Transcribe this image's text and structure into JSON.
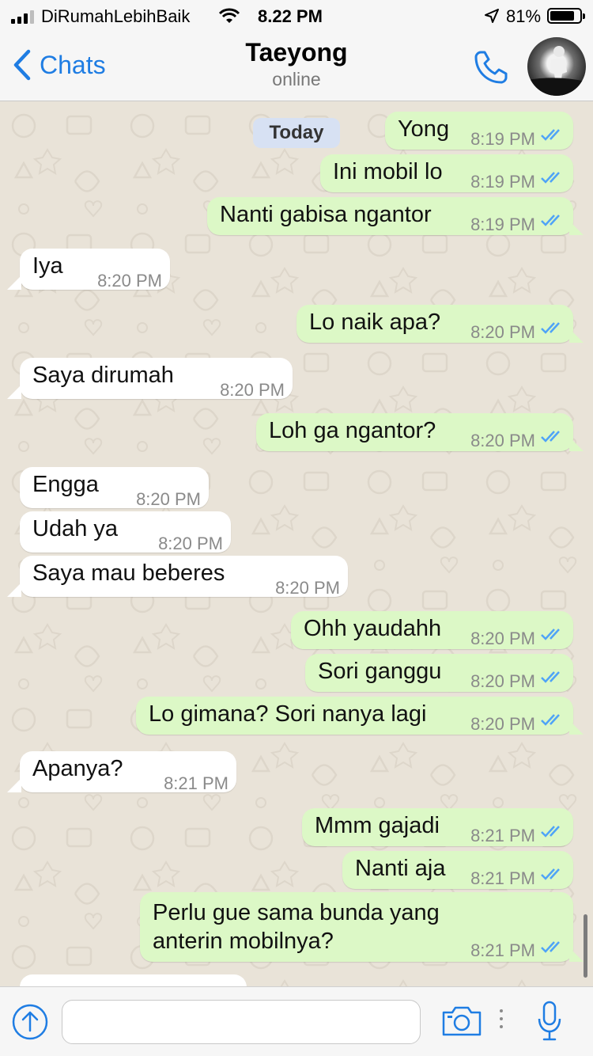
{
  "status_bar": {
    "carrier": "DiRumahLebihBaik",
    "time": "8.22 PM",
    "battery": "81%"
  },
  "header": {
    "back_label": "Chats",
    "contact_name": "Taeyong",
    "contact_status": "online"
  },
  "date_separator": "Today",
  "messages": [
    {
      "dir": "out",
      "text": "Yong",
      "time": "8:19 PM"
    },
    {
      "dir": "out",
      "text": "Ini mobil lo",
      "time": "8:19 PM"
    },
    {
      "dir": "out",
      "text": "Nanti gabisa ngantor",
      "time": "8:19 PM"
    },
    {
      "dir": "in",
      "text": "Iya",
      "time": "8:20 PM"
    },
    {
      "dir": "out",
      "text": "Lo naik apa?",
      "time": "8:20 PM"
    },
    {
      "dir": "in",
      "text": "Saya dirumah",
      "time": "8:20 PM"
    },
    {
      "dir": "out",
      "text": "Loh ga ngantor?",
      "time": "8:20 PM"
    },
    {
      "dir": "in",
      "text": "Engga",
      "time": "8:20 PM"
    },
    {
      "dir": "in",
      "text": "Udah ya",
      "time": "8:20 PM"
    },
    {
      "dir": "in",
      "text": "Saya mau beberes",
      "time": "8:20 PM"
    },
    {
      "dir": "out",
      "text": "Ohh yaudahh",
      "time": "8:20 PM"
    },
    {
      "dir": "out",
      "text": "Sori ganggu",
      "time": "8:20 PM"
    },
    {
      "dir": "out",
      "text": "Lo gimana? Sori nanya lagi",
      "time": "8:20 PM"
    },
    {
      "dir": "in",
      "text": "Apanya?",
      "time": "8:21 PM"
    },
    {
      "dir": "out",
      "text": "Mmm gajadi",
      "time": "8:21 PM"
    },
    {
      "dir": "out",
      "text": "Nanti aja",
      "time": "8:21 PM"
    },
    {
      "dir": "out",
      "text_line1": "Perlu gue sama bunda yang",
      "text_line2": "anterin mobilnya?",
      "time": "8:21 PM"
    }
  ],
  "input": {
    "value": "",
    "placeholder": ""
  },
  "icons": {
    "back": "chevron-left-icon",
    "call": "phone-icon",
    "attach": "arrow-up-circle-icon",
    "camera": "camera-icon",
    "mic": "microphone-icon",
    "read_receipt": "double-check-icon"
  },
  "colors": {
    "accent": "#1f7de3",
    "outgoing_bubble": "#dcf8c6",
    "incoming_bubble": "#ffffff",
    "read_ticks": "#4fa3f7",
    "chat_background": "#e9e3d8"
  }
}
